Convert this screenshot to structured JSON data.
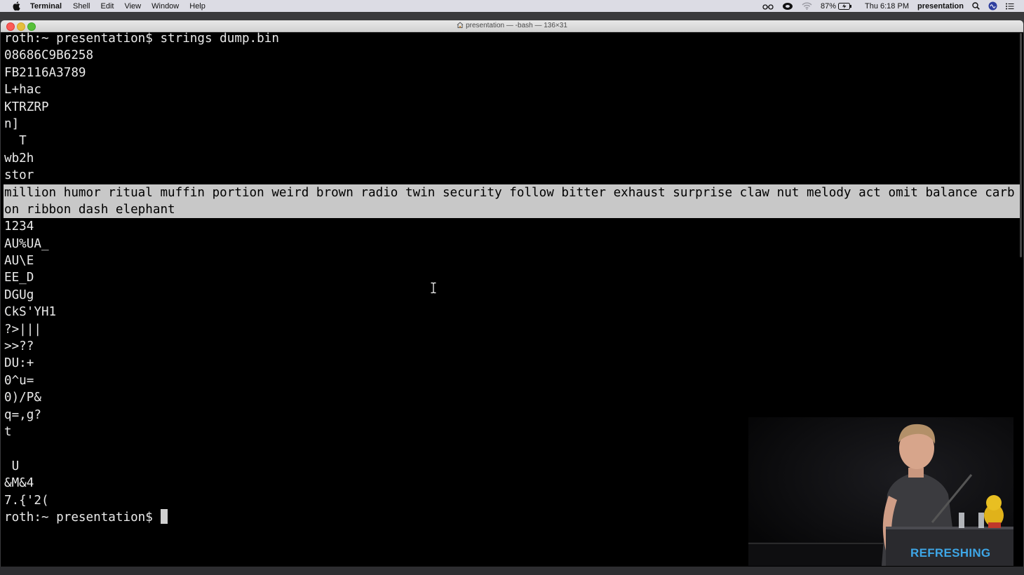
{
  "menubar": {
    "app_name": "Terminal",
    "menus": [
      "Shell",
      "Edit",
      "View",
      "Window",
      "Help"
    ],
    "battery": "87%",
    "clock": "Thu 6:18 PM",
    "user": "presentation"
  },
  "window": {
    "title": "presentation — -bash — 136×31"
  },
  "terminal": {
    "lines": [
      "roth:~ presentation$ strings dump.bin",
      "08686C9B6258",
      "FB2116A3789",
      "L+hac",
      "KTRZRP",
      "n]",
      "  T",
      "wb2h",
      "stor",
      "million humor ritual muffin portion weird brown radio twin security follow bitter exhaust surprise claw nut melody act omit balance carb",
      "on ribbon dash elephant",
      "1234",
      "AU%UA_",
      "AU\\E",
      "EE_D",
      "DGUg",
      "CkS'YH1",
      "?>|||",
      ">>??",
      "DU:+",
      "0^u=",
      "0)/P&",
      "q=,g?",
      "t",
      "",
      " U",
      "&M&4",
      "7.{'2(",
      "roth:~ presentation$ "
    ],
    "highlighted_lines": [
      9,
      10
    ],
    "prompt_line": 28
  },
  "video": {
    "brand": "REFRESHING"
  }
}
